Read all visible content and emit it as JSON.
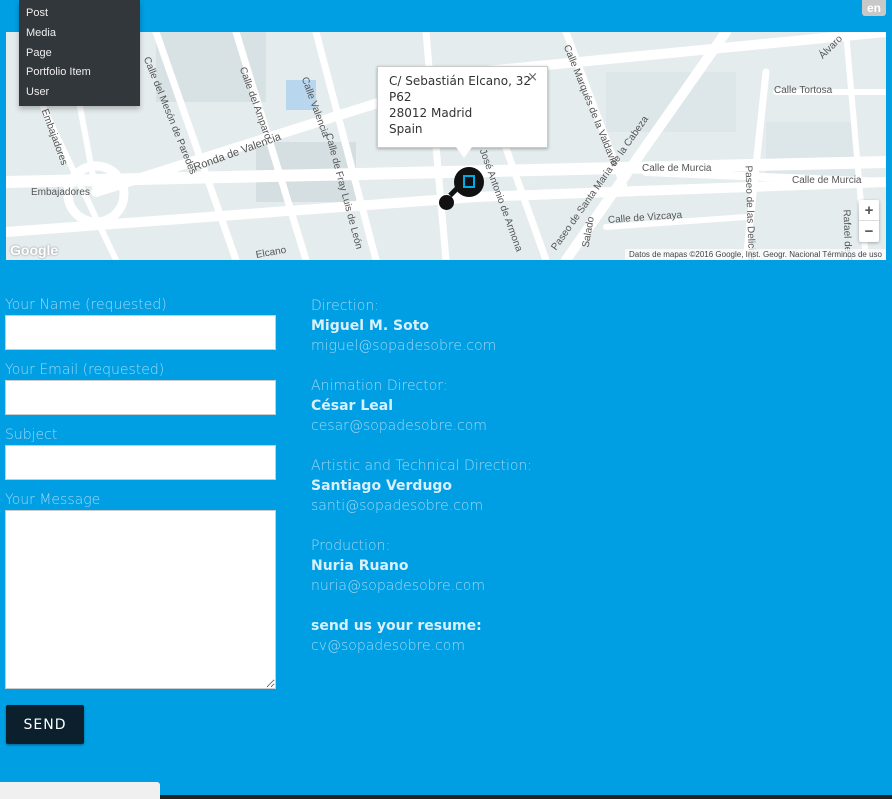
{
  "lang_badge": "en",
  "admin_menu": {
    "items": [
      "Post",
      "Media",
      "Page",
      "Portfolio Item",
      "User"
    ]
  },
  "map": {
    "info": {
      "line1": "C/ Sebastián Elcano, 32",
      "line2": "P62",
      "line3": "28012 Madrid",
      "line4": "Spain",
      "close": "×"
    },
    "labels": {
      "embajadores": "Embajadores",
      "ronda_valencia": "Ronda de Valencia",
      "calle_valencia": "Calle Valencia",
      "calle_amparo": "Calle del Amparo",
      "calle_meson": "Calle del Mesón de Paredes",
      "calle_fray": "Calle de Fray Luis de León",
      "calle_murcia1": "Calle de Murcia",
      "calle_murcia2": "Calle de Murcia",
      "calle_tortosa": "Calle Tortosa",
      "calle_vizcaya": "Calle de Vizcaya",
      "paseo_santa": "Paseo de Santa María de la Cabeza",
      "calle_marques": "Calle Marqués de la Valdavia",
      "jose_antonio": "José Antonio de Armona",
      "delicias": "Paseo de las Delicias",
      "embajadores_top": "Embajadores",
      "elcano": "Elcano",
      "alvaro": "Álvaro",
      "rafael": "Rafael de Riego",
      "salado": "Salado"
    },
    "google": "Google",
    "attribution": "Datos de mapas ©2016 Google, Inst. Geogr. Nacional    Términos de uso",
    "zoom_in": "+",
    "zoom_out": "−"
  },
  "form": {
    "name_label": "Your Name (requested)",
    "email_label": "Your Email (requested)",
    "subject_label": "Subject",
    "message_label": "Your Message",
    "send_label": "SEND"
  },
  "contacts": [
    {
      "role": "Direction:",
      "person": "Miguel M. Soto",
      "email": "miguel@sopadesobre.com"
    },
    {
      "role": "Animation Director:",
      "person": "César Leal",
      "email": "cesar@sopadesobre.com"
    },
    {
      "role": "Artistic and Technical Direction:",
      "person": "Santiago Verdugo",
      "email": "santi@sopadesobre.com"
    },
    {
      "role": "Production:",
      "person": "Nuria Ruano",
      "email": "nuria@sopadesobre.com"
    }
  ],
  "resume": {
    "title": "send us your resume:",
    "email": "cv@sopadesobre.com"
  },
  "colors": {
    "background": "#009ee3",
    "button": "#0b1f2c",
    "label": "#9ed8f5"
  }
}
